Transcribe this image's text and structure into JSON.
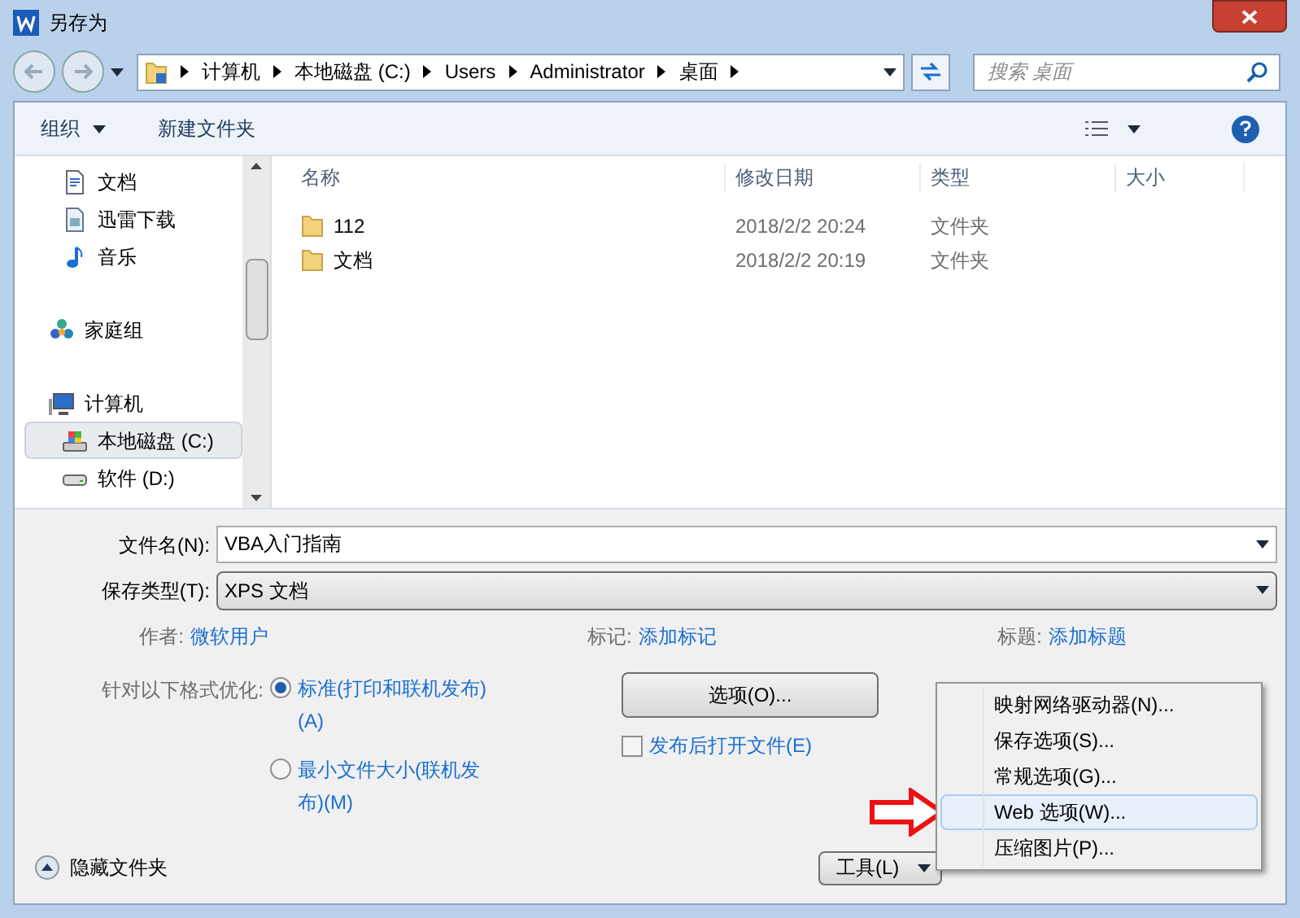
{
  "window": {
    "title": "另存为"
  },
  "address": {
    "segments": [
      "计算机",
      "本地磁盘 (C:)",
      "Users",
      "Administrator",
      "桌面"
    ]
  },
  "search": {
    "placeholder": "搜索 桌面"
  },
  "toolbar": {
    "organize": "组织",
    "new_folder": "新建文件夹"
  },
  "sidebar": [
    {
      "kind": "group",
      "children": [
        {
          "label": "文档",
          "kind": "document",
          "selected": false
        },
        {
          "label": "迅雷下载",
          "kind": "download",
          "selected": false
        },
        {
          "label": "音乐",
          "kind": "music",
          "selected": false
        }
      ]
    },
    {
      "label": "家庭组",
      "kind": "homegroup",
      "selected": false
    },
    {
      "label": "计算机",
      "kind": "computer",
      "selected": false,
      "children": [
        {
          "label": "本地磁盘 (C:)",
          "kind": "system-drive",
          "selected": true
        },
        {
          "label": "软件 (D:)",
          "kind": "drive",
          "selected": false
        }
      ]
    }
  ],
  "table": {
    "columns": [
      "名称",
      "修改日期",
      "类型",
      "大小"
    ],
    "rows": [
      {
        "name": "112",
        "modified": "2018/2/2 20:24",
        "type": "文件夹"
      },
      {
        "name": "文档",
        "modified": "2018/2/2 20:19",
        "type": "文件夹"
      }
    ]
  },
  "form": {
    "file_name_label": "文件名(N):",
    "file_name": "VBA入门指南",
    "file_type_label": "保存类型(T):",
    "file_type": "XPS 文档"
  },
  "metadata": [
    {
      "label": "作者:",
      "value": "微软用户"
    },
    {
      "label": "标记:",
      "value": "添加标记"
    },
    {
      "label": "标题:",
      "value": "添加标题"
    }
  ],
  "optimize": {
    "label": "针对以下格式优化:",
    "options": [
      {
        "label": "标准(打印和联机发布)(A)",
        "selected": true
      },
      {
        "label": "最小文件大小(联机发布)(M)",
        "selected": false
      }
    ]
  },
  "options_button": "选项(O)...",
  "open_after_publish": {
    "label": "发布后打开文件(E)",
    "checked": false
  },
  "hide_folders": "隐藏文件夹",
  "tools_button": "工具(L)",
  "tools_menu": [
    {
      "label": "映射网络驱动器(N)...",
      "selected": false
    },
    {
      "label": "保存选项(S)...",
      "selected": false
    },
    {
      "label": "常规选项(G)...",
      "selected": false
    },
    {
      "label": "Web 选项(W)...",
      "selected": true
    },
    {
      "label": "压缩图片(P)...",
      "selected": false
    }
  ]
}
